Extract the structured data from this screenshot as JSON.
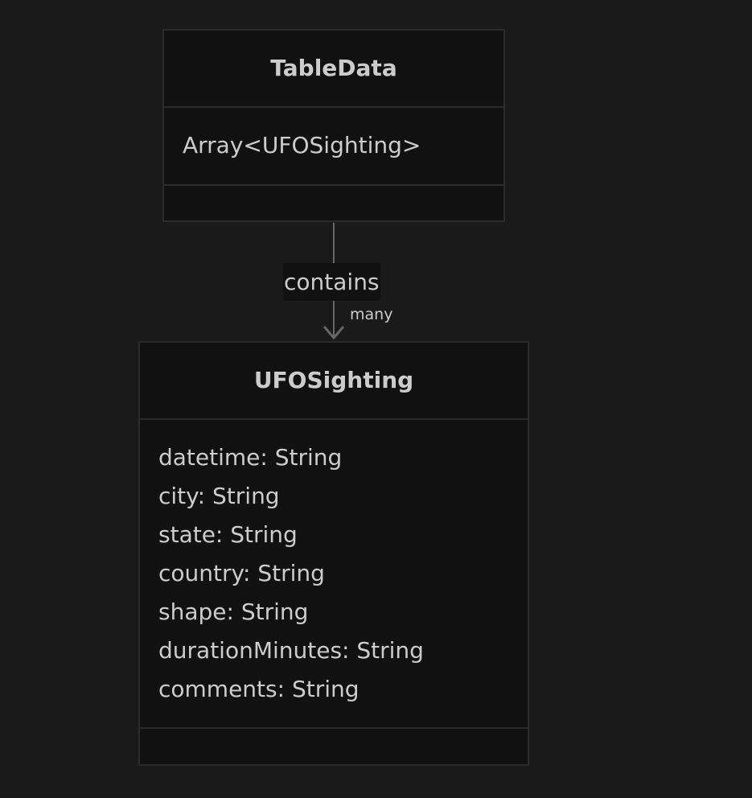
{
  "classes": [
    {
      "name": "TableData",
      "members": [
        "Array<UFOSighting>"
      ],
      "methods": []
    },
    {
      "name": "UFOSighting",
      "members": [
        "datetime: String",
        "city: String",
        "state: String",
        "country: String",
        "shape: String",
        "durationMinutes: String",
        "comments: String"
      ],
      "methods": []
    }
  ],
  "relation": {
    "label": "contains",
    "cardinality": "many",
    "arrow": "open-arrow-down"
  },
  "colors": {
    "background": "#1a1a1a",
    "box_fill": "#111111",
    "border": "#2b2b2b",
    "text": "#cccccc",
    "line": "#666666"
  }
}
